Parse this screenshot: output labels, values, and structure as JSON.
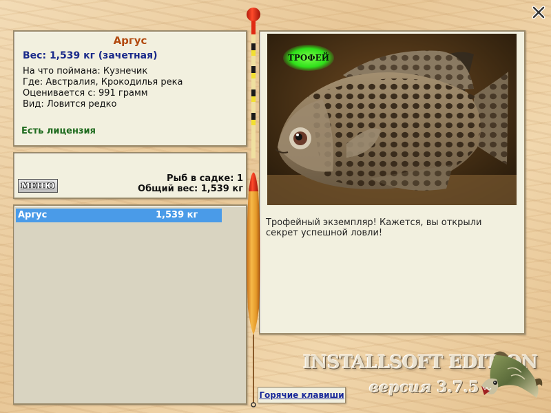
{
  "fish": {
    "name": "Аргус",
    "weight": "Вес: 1,539 кг (зачетная)",
    "bait": "На что поймана: Кузнечик",
    "location": "Где: Австралия, Крокодилья река",
    "price": "Оценивается с: 991 грамм",
    "rarity": "Вид: Ловится редко",
    "license": "Есть лицензия"
  },
  "stats": {
    "menu_label": "МЕНЮ",
    "fish_count": "Рыб в садке: 1",
    "total_weight": "Общий вес: 1,539 кг"
  },
  "catch_list": [
    {
      "name": "Аргус",
      "weight": "1,539 кг"
    }
  ],
  "photo": {
    "badge": "ТРОФЕЙ"
  },
  "description": "Трофейный экземпляр! Кажется, вы открыли секрет успешной ловли!",
  "footer": {
    "hotkeys": "Горячие клавиши",
    "edition": "INSTALLSOFT EDITION",
    "version_prefix": "версия",
    "version_number": "3.7.5"
  },
  "icons": {
    "close": "close-icon",
    "float": "fishing-float-icon",
    "pike": "pike-fish-icon"
  },
  "colors": {
    "selection": "#4a9be8",
    "fish_name": "#b24a10",
    "weight": "#1a2a8a",
    "license": "#1d6a1d"
  }
}
